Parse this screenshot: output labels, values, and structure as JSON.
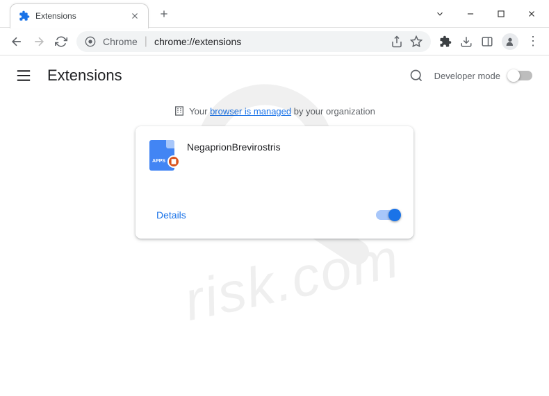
{
  "tab": {
    "title": "Extensions"
  },
  "omnibox": {
    "prefix": "Chrome",
    "url": "chrome://extensions"
  },
  "page": {
    "title": "Extensions"
  },
  "dev_mode": {
    "label": "Developer mode"
  },
  "managed": {
    "pre": "Your ",
    "link": "browser is managed",
    "post": " by your organization"
  },
  "extension": {
    "name": "NegaprionBrevirostris",
    "icon_apps_text": "APPS",
    "details_label": "Details"
  },
  "watermark": {
    "text": "risk.com"
  }
}
